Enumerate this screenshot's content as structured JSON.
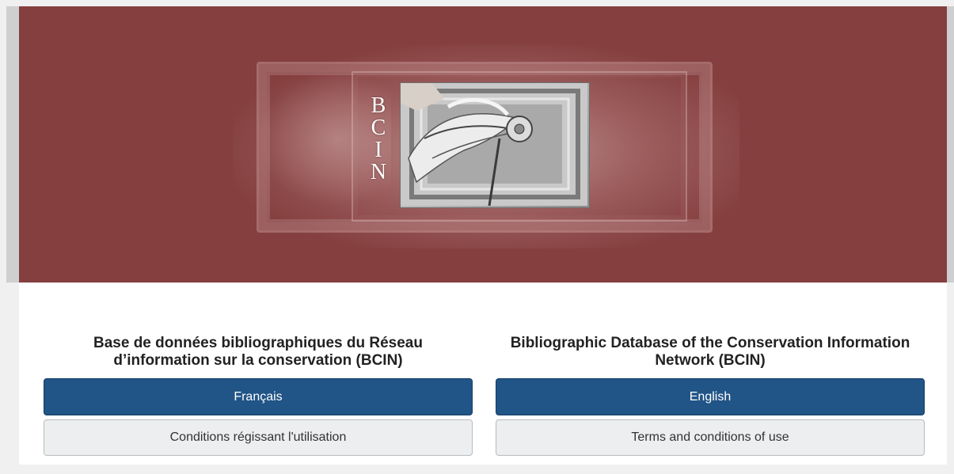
{
  "banner": {
    "logo_letters": [
      "B",
      "C",
      "I",
      "N"
    ],
    "background_color": "#853f3f"
  },
  "french": {
    "heading": "Base de données bibliographiques du Réseau d’information sur la conservation (BCIN)",
    "language_button": "Français",
    "terms_button": "Conditions régissant l'utilisation"
  },
  "english": {
    "heading": "Bibliographic Database of the Conservation Information Network (BCIN)",
    "language_button": "English",
    "terms_button": "Terms and conditions of use"
  },
  "colors": {
    "primary_button": "#215487",
    "secondary_button": "#eceeef"
  }
}
